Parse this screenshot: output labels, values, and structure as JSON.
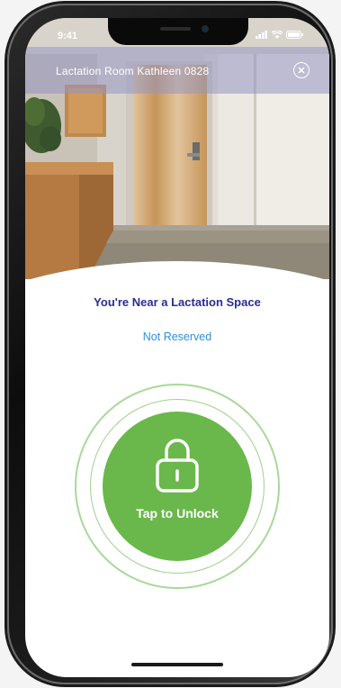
{
  "status_bar": {
    "time": "9:41"
  },
  "header": {
    "room_title": "Lactation Room Kathleen 0828",
    "close_icon": "close-circle-icon"
  },
  "main": {
    "near_title": "You're Near a Lactation Space",
    "reservation_status": "Not Reserved",
    "unlock_label": "Tap to Unlock",
    "lock_icon": "lock-icon"
  },
  "colors": {
    "title": "#2a2d8f",
    "status": "#2f8fd8",
    "unlock_green": "#6ab84b",
    "ring_green": "#a9d89a"
  }
}
